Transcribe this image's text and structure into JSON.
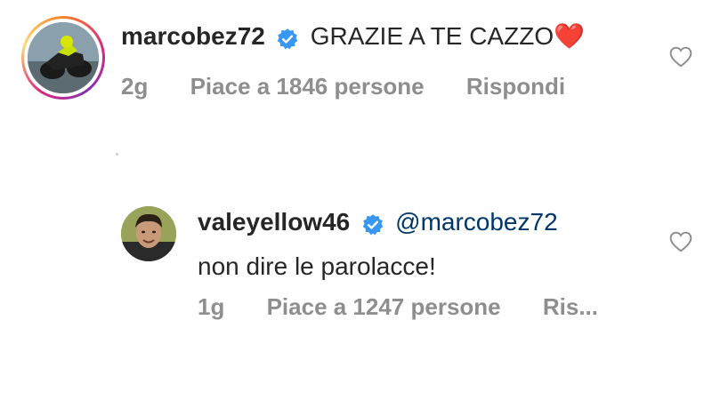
{
  "comments": [
    {
      "username": "marcobez72",
      "text": "GRAZIE A TE CAZZO",
      "emoji": "❤️",
      "time": "2g",
      "likes": "Piace a 1846 persone",
      "reply": "Rispondi"
    },
    {
      "username": "valeyellow46",
      "mention": "@marcobez72",
      "text": "non dire le parolacce!",
      "time": "1g",
      "likes": "Piace a 1247 persone",
      "reply": "Ris..."
    }
  ],
  "colors": {
    "verified": "#3897f0",
    "meta": "#8e8e8e",
    "mention": "#00376b",
    "heart": "#ed1c24"
  }
}
